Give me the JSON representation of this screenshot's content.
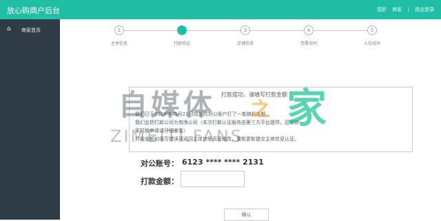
{
  "header": {
    "title": "放心购商户后台",
    "right": [
      "您好",
      "商家",
      "|",
      "退出登录"
    ]
  },
  "sidebar": {
    "items": [
      {
        "icon": "home-icon",
        "label": "商家首页"
      }
    ]
  },
  "progress": {
    "steps": [
      {
        "number": "1",
        "label": "主体信息"
      },
      {
        "number": "2",
        "label": "打款验证"
      },
      {
        "number": "3",
        "label": "店铺信息"
      },
      {
        "number": "4",
        "label": "签署合同"
      },
      {
        "number": "5",
        "label": "入驻成功"
      }
    ],
    "active_index": 1
  },
  "notice": {
    "title": "打款成功，请填写打款金额",
    "lines": [
      "我们已于2019年05月21日向您的对公账户打了一笔随机金额。",
      "我们会把打款公司为有限公司（本次打款认证服务由第三方平台提供，后续商",
      "家打款申请请仔细查看）",
      "打款金额如填写错误请返回主体信息页面修改，重新更新提交主体信息认证。"
    ]
  },
  "watermark": {
    "cn": "自媒体",
    "zhi": "之",
    "jia": "家",
    "en": "ZIMEITI.FANS"
  },
  "form": {
    "account_label": "对公账号：",
    "account_value": "6123 **** **** 2131",
    "amount_label": "打款金额：",
    "amount_value": "",
    "confirm_label": "确认"
  },
  "colors": {
    "header_bg": "#1fbfa6",
    "sidebar_bg": "#2f3b45",
    "active_step": "#1fbfa6"
  }
}
